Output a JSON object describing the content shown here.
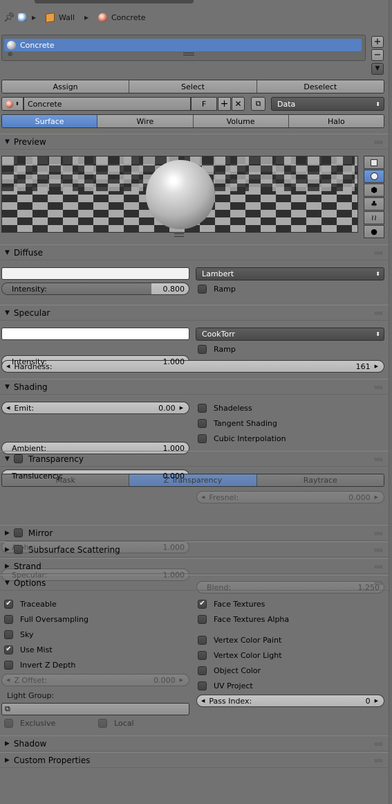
{
  "breadcrumb": {
    "object": "Wall",
    "material": "Concrete"
  },
  "material_slots": {
    "items": [
      "Concrete"
    ]
  },
  "slot_buttons": {
    "assign": "Assign",
    "select": "Select",
    "deselect": "Deselect"
  },
  "datablock": {
    "name": "Concrete",
    "fake_user": "F",
    "link": "Data"
  },
  "context_tabs": {
    "items": [
      "Surface",
      "Wire",
      "Volume",
      "Halo"
    ],
    "active": "Surface"
  },
  "panels": {
    "preview": "Preview",
    "diffuse": "Diffuse",
    "specular": "Specular",
    "shading": "Shading",
    "transparency": "Transparency",
    "mirror": "Mirror",
    "sss": "Subsurface Scattering",
    "strand": "Strand",
    "options": "Options",
    "shadow": "Shadow",
    "custom_props": "Custom Properties"
  },
  "diffuse": {
    "color": "#f2f2f2",
    "shader": "Lambert",
    "intensity_label": "Intensity:",
    "intensity": "0.800",
    "intensity_fraction": 0.8,
    "ramp": "Ramp"
  },
  "specular": {
    "color": "#ffffff",
    "shader": "CookTorr",
    "intensity_label": "Intensity:",
    "intensity": "1.000",
    "ramp": "Ramp",
    "hardness_label": "Hardness:",
    "hardness": "161"
  },
  "shading": {
    "emit_label": "Emit:",
    "emit": "0.00",
    "ambient_label": "Ambient:",
    "ambient": "1.000",
    "translucency_label": "Translucency:",
    "translucency": "0.000",
    "shadeless": "Shadeless",
    "tangent": "Tangent Shading",
    "cubic": "Cubic Interpolation"
  },
  "transparency": {
    "modes": [
      "Mask",
      "Z Transparency",
      "Raytrace"
    ],
    "active": "Z Transparency",
    "alpha_label": "Alpha:",
    "alpha": "1.000",
    "specular_label": "Specular:",
    "specular": "1.000",
    "fresnel_label": "Fresnel:",
    "fresnel": "0.000",
    "blend_label": "Blend:",
    "blend": "1.250"
  },
  "options": {
    "traceable": "Traceable",
    "full_oversampling": "Full Oversampling",
    "sky": "Sky",
    "use_mist": "Use Mist",
    "invert_z": "Invert Z Depth",
    "z_offset_label": "Z Offset:",
    "z_offset": "0.000",
    "light_group": "Light Group:",
    "exclusive": "Exclusive",
    "local": "Local",
    "face_textures": "Face Textures",
    "face_textures_alpha": "Face Textures Alpha",
    "vertex_color_paint": "Vertex Color Paint",
    "vertex_color_light": "Vertex Color Light",
    "object_color": "Object Color",
    "uv_project": "UV Project",
    "pass_index_label": "Pass Index:",
    "pass_index": "0",
    "checked": [
      "traceable",
      "use_mist",
      "face_textures"
    ]
  },
  "colors": {
    "accent": "#5680c2",
    "panel_bg": "#727272"
  }
}
